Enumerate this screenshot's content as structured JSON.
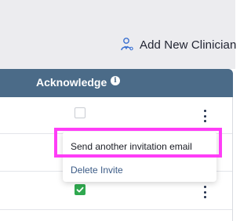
{
  "header": {
    "add_clinician_label": "Add New Clinician",
    "add_clinician_icon": "user-add-icon"
  },
  "table": {
    "columns": [
      {
        "label": "Acknowledge",
        "icon": "info-icon"
      }
    ],
    "rows": [
      {
        "acknowledged": false,
        "actions_icon": "kebab-menu-icon"
      },
      {
        "acknowledged": null,
        "actions_icon": "kebab-menu-icon"
      },
      {
        "acknowledged": true,
        "actions_icon": "kebab-menu-icon"
      }
    ]
  },
  "context_menu": {
    "items": [
      {
        "label": "Send another invitation email"
      },
      {
        "label": "Delete Invite"
      }
    ]
  },
  "colors": {
    "header_bg": "#4b6b88",
    "checked_green": "#2fa84f",
    "highlight_magenta": "#ff3df7",
    "link_blue": "#3b5b86"
  }
}
